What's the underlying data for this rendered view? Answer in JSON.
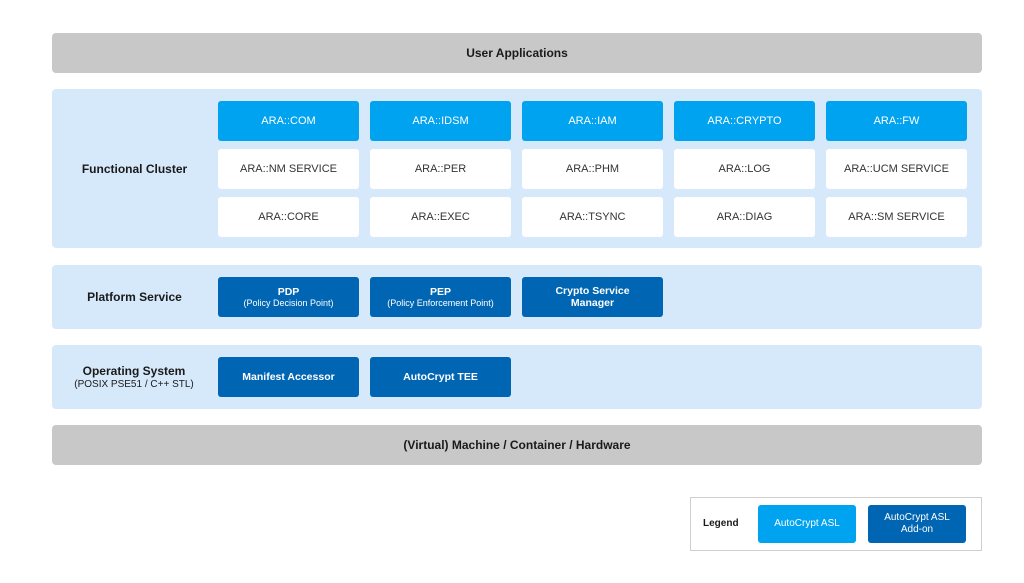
{
  "top_band": "User Applications",
  "bottom_band": "(Virtual) Machine / Container / Hardware",
  "functional_cluster": {
    "label": "Functional Cluster",
    "addon_row": [
      "ARA::COM",
      "ARA::IDSM",
      "ARA::IAM",
      "ARA::CRYPTO",
      "ARA::FW"
    ],
    "row2": [
      "ARA::NM SERVICE",
      "ARA::PER",
      "ARA::PHM",
      "ARA::LOG",
      "ARA::UCM SERVICE"
    ],
    "row3": [
      "ARA::CORE",
      "ARA::EXEC",
      "ARA::TSYNC",
      "ARA::DIAG",
      "ARA::SM SERVICE"
    ]
  },
  "platform_service": {
    "label": "Platform Service",
    "items": [
      {
        "title": "PDP",
        "subtitle": "(Policy Decision Point)"
      },
      {
        "title": "PEP",
        "subtitle": "(Policy Enforcement Point)"
      },
      {
        "title": "Crypto Service Manager",
        "subtitle": ""
      }
    ]
  },
  "operating_system": {
    "label": "Operating System",
    "sublabel": "(POSIX PSE51 / C++ STL)",
    "items": [
      "Manifest Accessor",
      "AutoCrypt TEE"
    ]
  },
  "legend": {
    "title": "Legend",
    "asl": "AutoCrypt ASL",
    "addon": "AutoCrypt ASL Add-on",
    "colors": {
      "asl": "#00a3ef",
      "addon": "#0066b3"
    }
  }
}
